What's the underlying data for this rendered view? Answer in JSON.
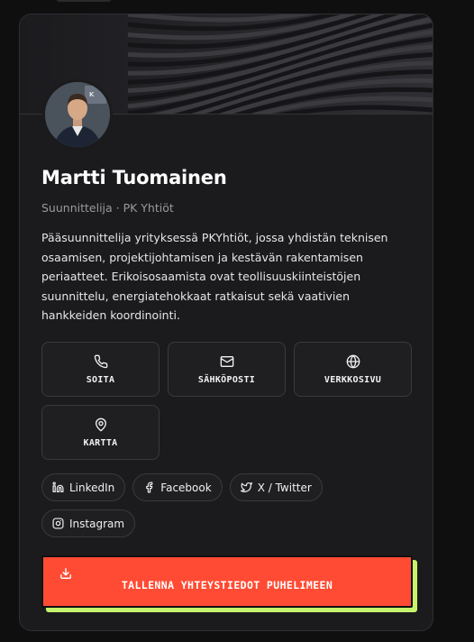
{
  "profile": {
    "name": "Martti Tuomainen",
    "subtitle": "Suunnittelija · PK Yhtiöt",
    "bio": "Pääsuunnittelija yrityksessä PKYhtiöt, jossa yhdistän teknisen osaamisen, projektijohtamisen ja kestävän rakentamisen periaatteet. Erikoisosaamista ovat teollisuuskiinteistöjen suunnittelu, energiatehokkaat ratkaisut sekä vaativien hankkeiden koordinointi.",
    "avatar_icon": "person-photo"
  },
  "actions": [
    {
      "label": "SOITA",
      "icon": "phone-icon"
    },
    {
      "label": "SÄHKÖPOSTI",
      "icon": "mail-icon"
    },
    {
      "label": "VERKKOSIVU",
      "icon": "globe-icon"
    },
    {
      "label": "KARTTA",
      "icon": "map-pin-icon"
    }
  ],
  "socials": [
    {
      "label": "LinkedIn",
      "icon": "linkedin-icon"
    },
    {
      "label": "Facebook",
      "icon": "facebook-icon"
    },
    {
      "label": "X / Twitter",
      "icon": "twitter-icon"
    },
    {
      "label": "Instagram",
      "icon": "instagram-icon"
    }
  ],
  "save": {
    "label": "TALLENNA YHTEYSTIEDOT PUHELIMEEN",
    "icon": "download-icon"
  },
  "colors": {
    "background": "#0f0f10",
    "card": "#1b1b1d",
    "save_button": "#ff4b33",
    "save_shadow": "#c6f36b"
  }
}
